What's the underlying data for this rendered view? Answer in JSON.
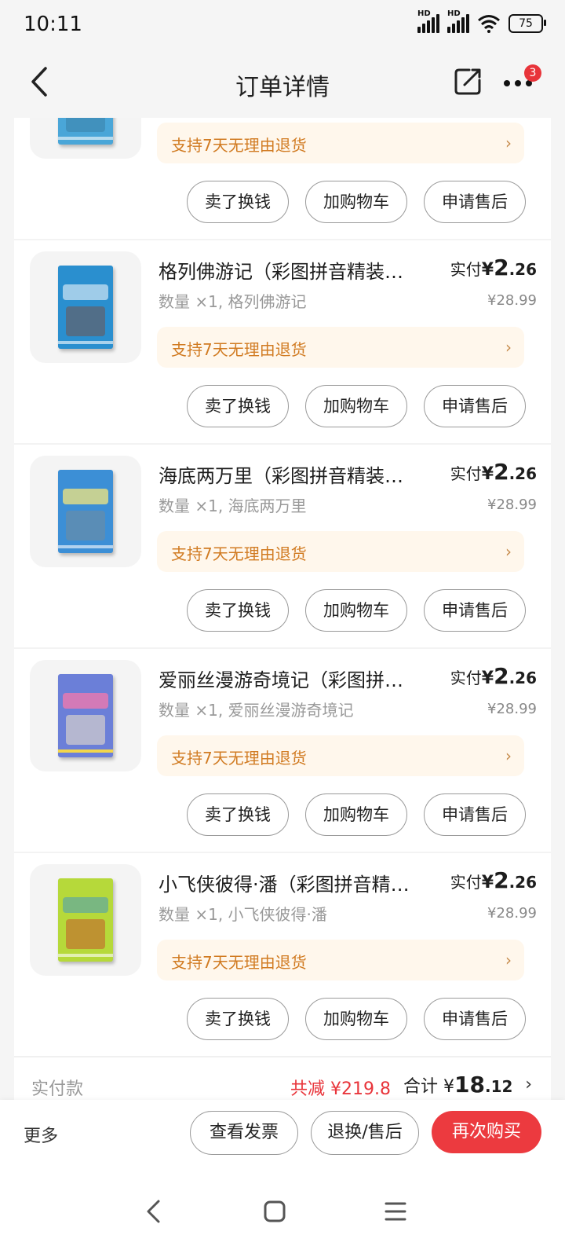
{
  "status_bar": {
    "time": "10:11",
    "signal1": "HD",
    "signal2": "HD",
    "battery": "75"
  },
  "header": {
    "title": "订单详情",
    "badge_count": "3"
  },
  "colors": {
    "accent": "#ec3a3f",
    "return_bg": "#fff7ec",
    "return_text": "#d17b22"
  },
  "top_partial_item": {
    "return_label": "支持7天无理由退货",
    "buttons": [
      "卖了换钱",
      "加购物车",
      "申请售后"
    ]
  },
  "items": [
    {
      "name": "格列佛游记（彩图拼音精装…",
      "paid_label": "实付",
      "currency": "¥",
      "price_int": "2",
      "price_dec": ".26",
      "quantity": "数量 ×1, 格列佛游记",
      "original_price": "¥28.99",
      "return_label": "支持7天无理由退货",
      "buttons": [
        "卖了换钱",
        "加购物车",
        "申请售后"
      ],
      "cover_color": "#2a8fcf"
    },
    {
      "name": "海底两万里（彩图拼音精装…",
      "paid_label": "实付",
      "currency": "¥",
      "price_int": "2",
      "price_dec": ".26",
      "quantity": "数量 ×1, 海底两万里",
      "original_price": "¥28.99",
      "return_label": "支持7天无理由退货",
      "buttons": [
        "卖了换钱",
        "加购物车",
        "申请售后"
      ],
      "cover_color": "#3c8fd6"
    },
    {
      "name": "爱丽丝漫游奇境记（彩图拼…",
      "paid_label": "实付",
      "currency": "¥",
      "price_int": "2",
      "price_dec": ".26",
      "quantity": "数量 ×1, 爱丽丝漫游奇境记",
      "original_price": "¥28.99",
      "return_label": "支持7天无理由退货",
      "buttons": [
        "卖了换钱",
        "加购物车",
        "申请售后"
      ],
      "cover_color": "#6b7fd8"
    },
    {
      "name": "小飞侠彼得·潘（彩图拼音精…",
      "paid_label": "实付",
      "currency": "¥",
      "price_int": "2",
      "price_dec": ".26",
      "quantity": "数量 ×1, 小飞侠彼得·潘",
      "original_price": "¥28.99",
      "return_label": "支持7天无理由退货",
      "buttons": [
        "卖了换钱",
        "加购物车",
        "申请售后"
      ],
      "cover_color": "#b6d93a"
    }
  ],
  "summary": {
    "label": "实付款",
    "discount": "共减 ¥219.8",
    "total_label": "合计 ¥",
    "total_int": "18",
    "total_dec": ".12"
  },
  "actions": {
    "more": "更多",
    "invoice": "查看发票",
    "refund": "退换/售后",
    "rebuy": "再次购买"
  }
}
